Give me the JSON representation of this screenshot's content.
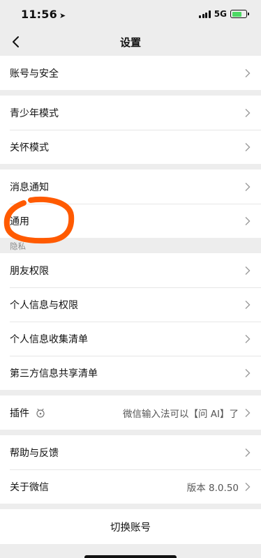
{
  "status": {
    "time": "11:56",
    "network": "5G"
  },
  "header": {
    "title": "设置"
  },
  "groups": {
    "account": {
      "label": "账号与安全"
    },
    "teen": {
      "label": "青少年模式"
    },
    "care": {
      "label": "关怀模式"
    },
    "notify": {
      "label": "消息通知"
    },
    "general": {
      "label": "通用"
    },
    "privacy_header": "隐私",
    "friends": {
      "label": "朋友权限"
    },
    "personal": {
      "label": "个人信息与权限"
    },
    "collect": {
      "label": "个人信息收集清单"
    },
    "thirdparty": {
      "label": "第三方信息共享清单"
    },
    "plugins": {
      "label": "插件",
      "value": "微信输入法可以【问 AI】了"
    },
    "help": {
      "label": "帮助与反馈"
    },
    "about": {
      "label": "关于微信",
      "value": "版本 8.0.50"
    }
  },
  "footer": {
    "switch_account": "切换账号"
  },
  "icons": [
    "location-arrow-icon",
    "signal-icon",
    "battery-charging-icon",
    "back-chevron-icon",
    "chevron-right-icon",
    "plugin-badge-icon"
  ],
  "colors": {
    "background": "#ededed",
    "annotation": "#ff5a00",
    "battery": "#4cd964"
  }
}
